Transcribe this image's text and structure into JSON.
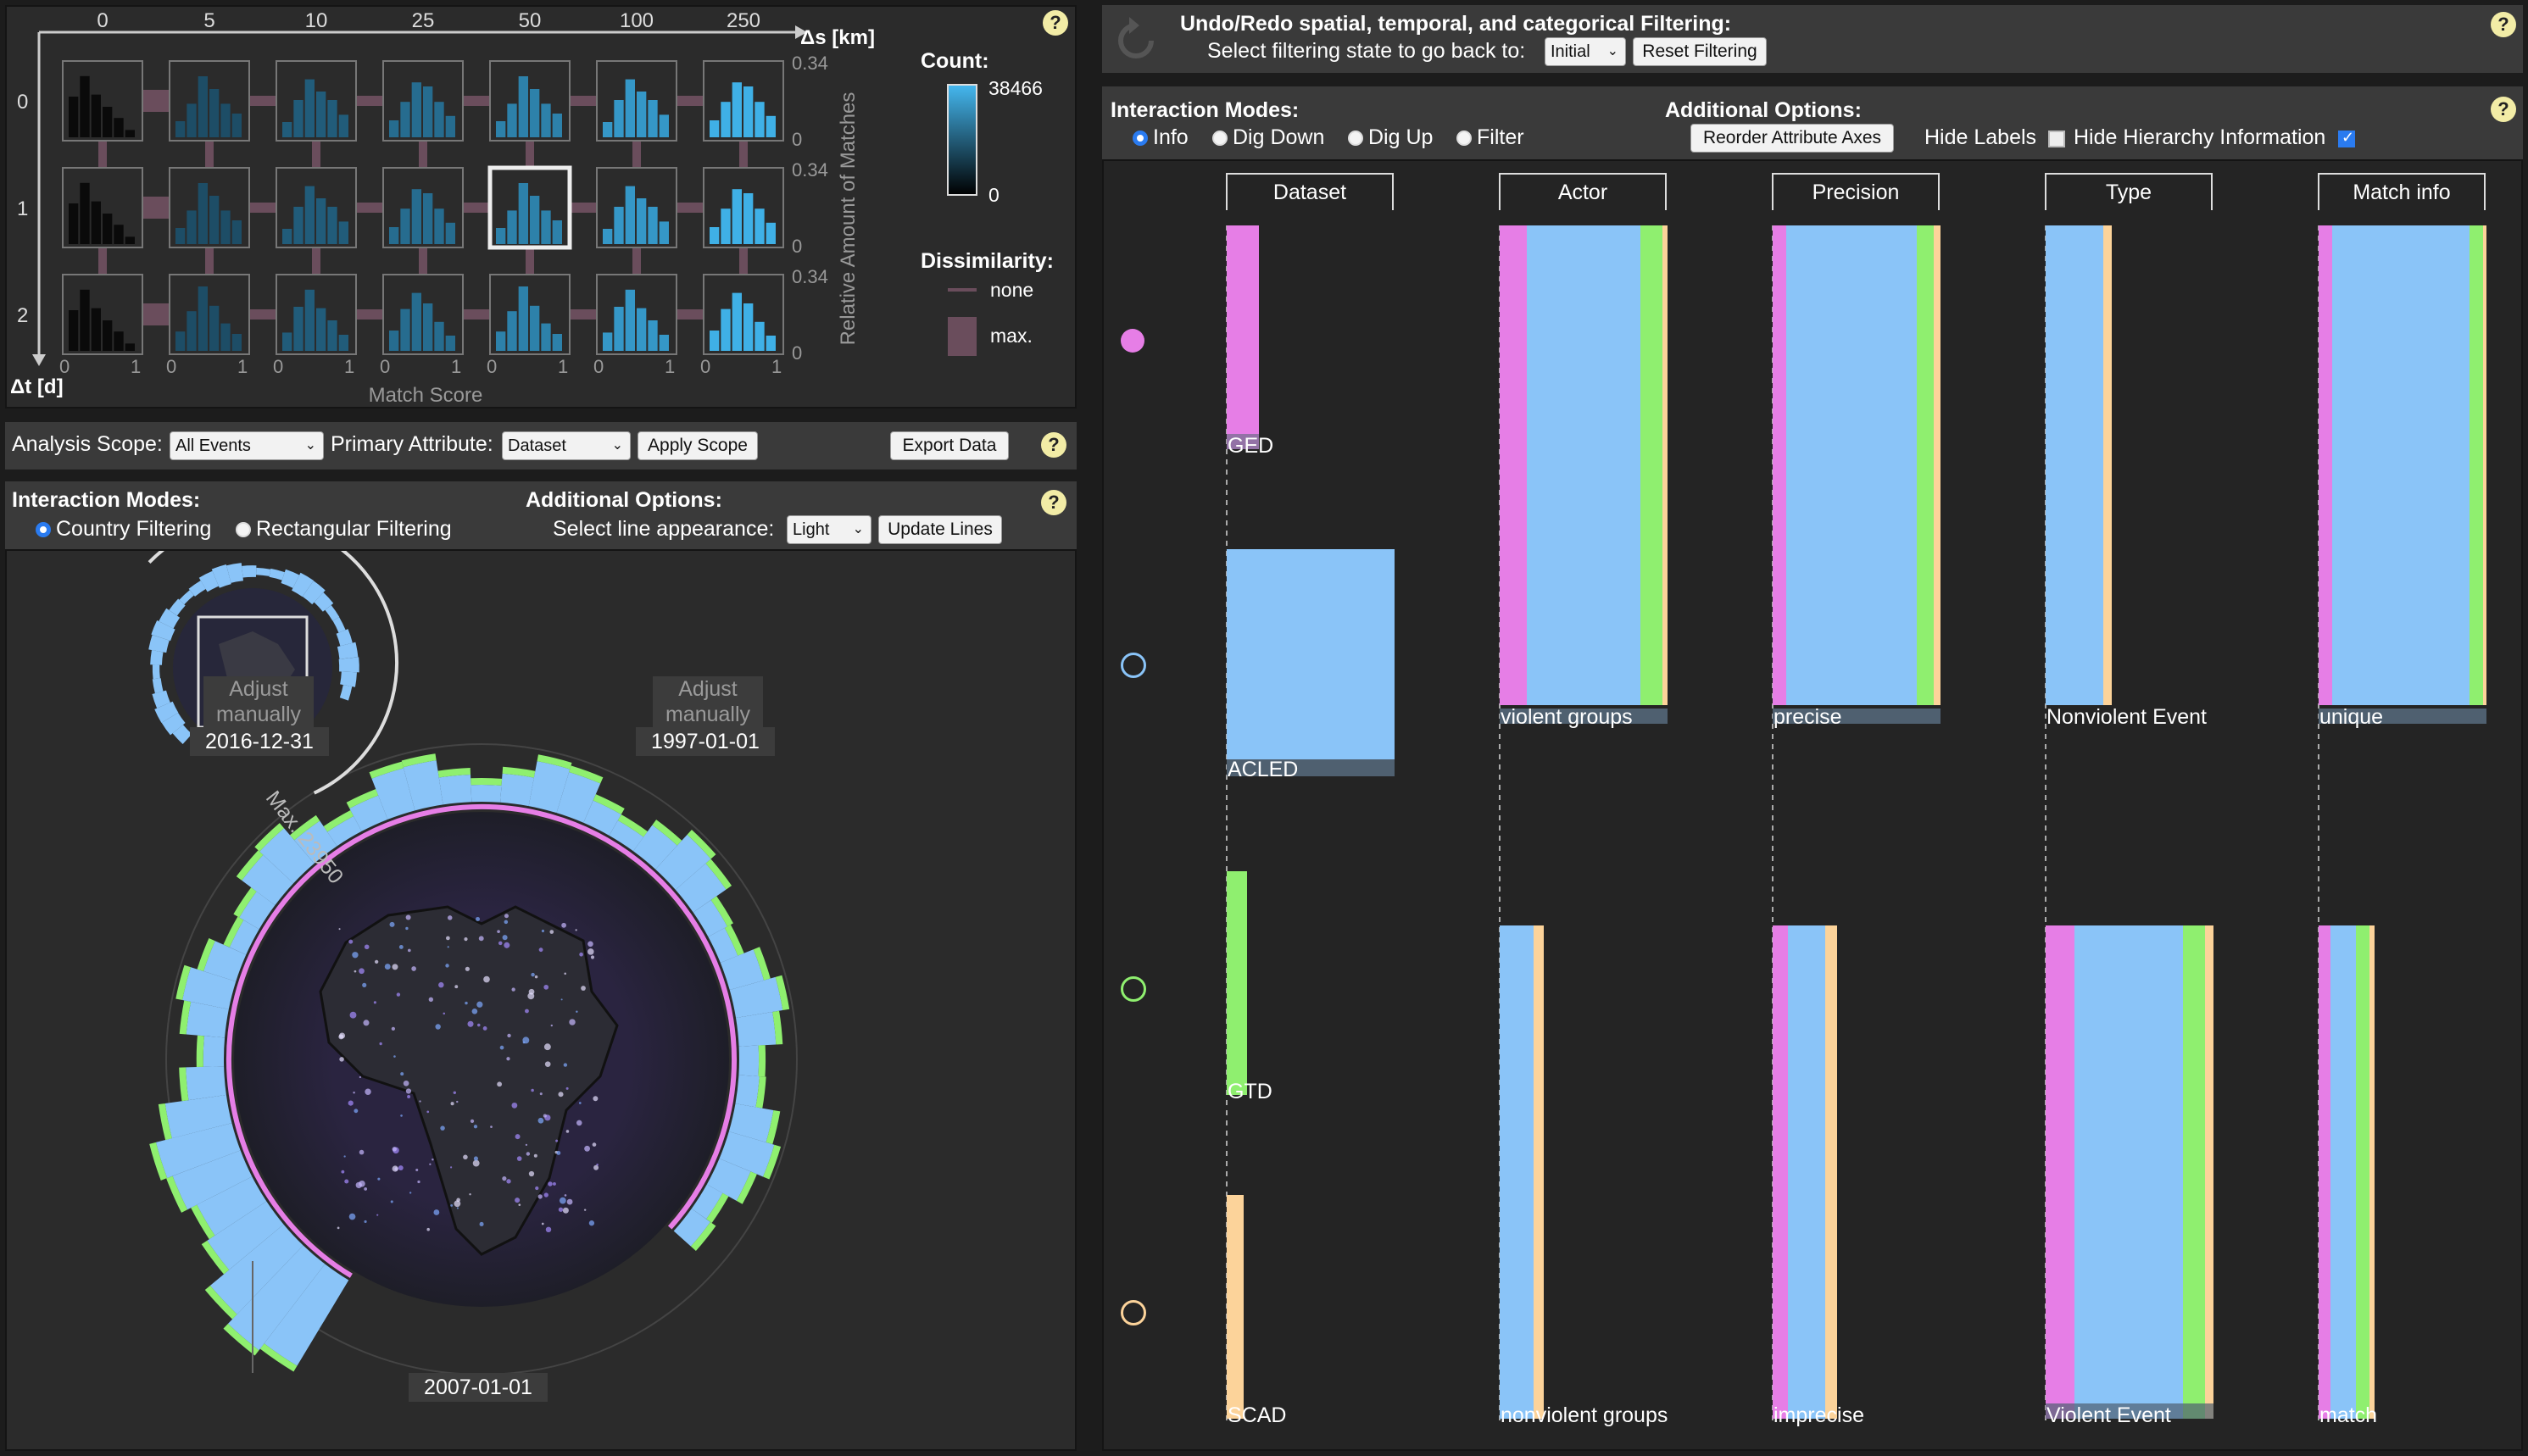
{
  "matrix": {
    "col_ticks": [
      "0",
      "5",
      "10",
      "25",
      "50",
      "100",
      "250"
    ],
    "ds_label": "Δs [km]",
    "row_ticks": [
      "0",
      "1",
      "2"
    ],
    "dt_label": "Δt [d]",
    "x_ticks": [
      "0",
      "1"
    ],
    "x_label": "Match Score",
    "y_tick_max": "0.34",
    "y_tick_min": "0",
    "y_label": "Relative Amount of Matches",
    "count_title": "Count:",
    "count_max": "38466",
    "count_min": "0",
    "dissim_title": "Dissimilarity:",
    "dissim_none": "none",
    "dissim_max": "max."
  },
  "scope_bar": {
    "scope_label": "Analysis Scope:",
    "scope_value": "All Events",
    "primary_label": "Primary Attribute:",
    "primary_value": "Dataset",
    "apply_label": "Apply Scope",
    "export_label": "Export Data"
  },
  "map_bar": {
    "modes_title": "Interaction Modes:",
    "mode_country": "Country Filtering",
    "mode_rect": "Rectangular Filtering",
    "options_title": "Additional Options:",
    "line_label": "Select line appearance:",
    "line_value": "Light",
    "update_label": "Update Lines"
  },
  "radial": {
    "adjust_left": "Adjust manually",
    "adjust_right": "Adjust manually",
    "date_left": "2016-12-31",
    "date_right": "1997-01-01",
    "date_bottom": "2007-01-01",
    "max_label": "Max. 23950"
  },
  "undo_bar": {
    "title": "Undo/Redo spatial, temporal, and categorical Filtering:",
    "sub": "Select filtering state to go back to:",
    "state_value": "Initial",
    "reset_label": "Reset Filtering"
  },
  "parsets_bar": {
    "modes_title": "Interaction Modes:",
    "mode_info": "Info",
    "mode_dig_down": "Dig Down",
    "mode_dig_up": "Dig Up",
    "mode_filter": "Filter",
    "options_title": "Additional Options:",
    "reorder_label": "Reorder Attribute Axes",
    "hide_labels": "Hide Labels",
    "hide_hierarchy": "Hide Hierarchy Information"
  },
  "parsets": {
    "axes": [
      "Dataset",
      "Actor",
      "Precision",
      "Type",
      "Match info"
    ],
    "dataset_labels": [
      "GED",
      "ACLED",
      "GTD",
      "SCAD"
    ],
    "actor_labels": [
      "violent groups",
      "nonviolent groups"
    ],
    "precision_labels": [
      "precise",
      "imprecise"
    ],
    "type_labels": [
      "Nonviolent Event",
      "Violent Event"
    ],
    "match_labels": [
      "unique",
      "match"
    ]
  },
  "colors": {
    "ged": "#e67ee6",
    "acled": "#8ac4f8",
    "gtd": "#8fef6f",
    "scad": "#fcd39a"
  }
}
